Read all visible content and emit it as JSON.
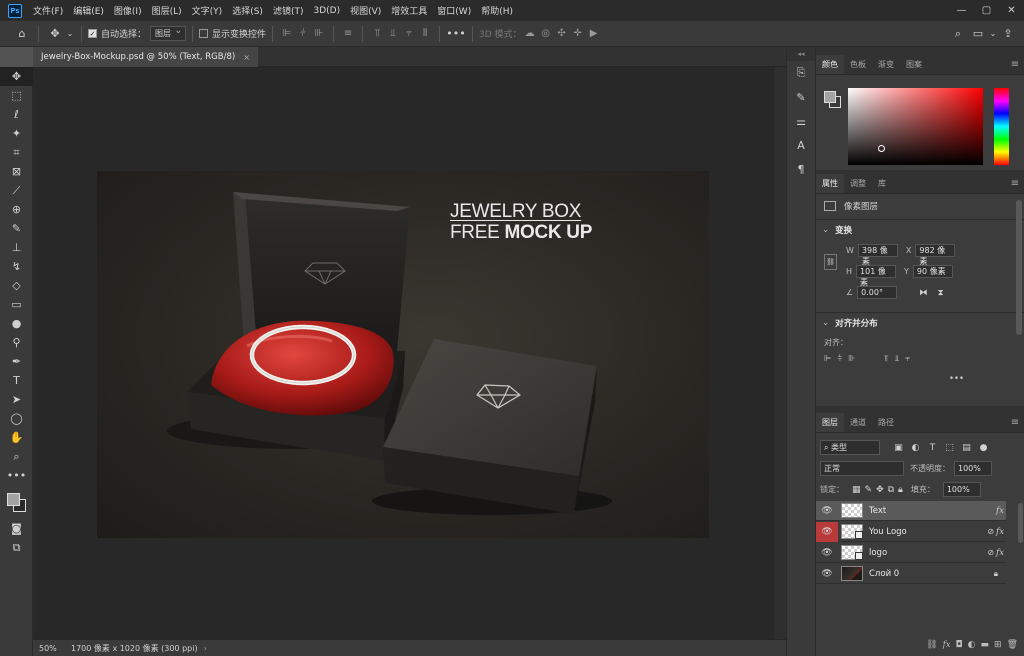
{
  "app": {
    "logo_text": "Ps"
  },
  "menu": [
    "文件(F)",
    "编辑(E)",
    "图像(I)",
    "图层(L)",
    "文字(Y)",
    "选择(S)",
    "滤镜(T)",
    "3D(D)",
    "视图(V)",
    "增效工具",
    "窗口(W)",
    "帮助(H)"
  ],
  "window_controls": {
    "minimize": "—",
    "maximize": "▢",
    "close": "✕"
  },
  "options": {
    "auto_select_label": "自动选择：",
    "auto_select_value": "图层",
    "show_transform_label": "显示变换控件",
    "mode_3d_label": "3D 模式："
  },
  "document": {
    "tab_title": "Jewelry-Box-Mockup.psd @ 50% (Text, RGB/8)",
    "tab_close": "×",
    "image_title_line1": "JEWELRY BOX",
    "image_title_line2_a": "FREE ",
    "image_title_line2_b": "MOCK UP"
  },
  "status": {
    "zoom": "50%",
    "info": "1700 像素 x 1020 像素 (300 ppi)",
    "arrow": "›"
  },
  "color_panel": {
    "tabs": [
      "颜色",
      "色板",
      "渐变",
      "图案"
    ],
    "fg_color": "#a3a3a3",
    "bg_color": "#3a3a3a"
  },
  "properties": {
    "tabs": [
      "属性",
      "调整",
      "库"
    ],
    "layer_type": "像素图层",
    "transform_heading": "变换",
    "w_label": "W",
    "w_value": "398 像素",
    "x_label": "X",
    "x_value": "982 像素",
    "h_label": "H",
    "h_value": "101 像素",
    "y_label": "Y",
    "y_value": "90 像素",
    "angle_value": "0.00°",
    "align_heading": "对齐并分布",
    "align_label": "对齐："
  },
  "layers": {
    "tabs": [
      "图层",
      "通道",
      "路径"
    ],
    "filter_label": "类型",
    "blend_mode": "正常",
    "opacity_label": "不透明度：",
    "opacity_value": "100%",
    "lock_label": "锁定：",
    "fill_label": "填充：",
    "fill_value": "100%",
    "items": [
      {
        "name": "Text",
        "selected": true,
        "fx": "fx"
      },
      {
        "name": "You Logo",
        "selected": false,
        "fx": "fx"
      },
      {
        "name": "logo",
        "selected": false,
        "fx": "fx"
      },
      {
        "name": "Слой 0",
        "selected": false,
        "fx": ""
      }
    ]
  }
}
